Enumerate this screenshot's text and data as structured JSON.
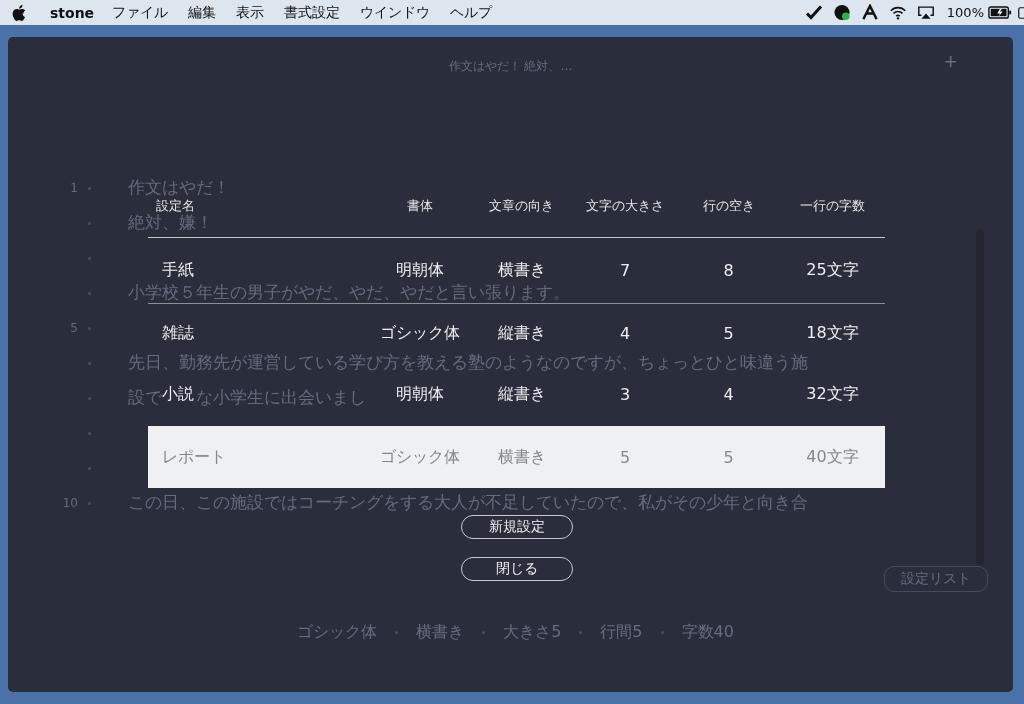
{
  "menu_bar": {
    "app": "stone",
    "menus": [
      "ファイル",
      "編集",
      "表示",
      "書式設定",
      "ウインドウ",
      "ヘルプ"
    ],
    "battery_percent": "100%"
  },
  "window": {
    "title": "作文はやだ！ 絶対、…",
    "add_button": "+"
  },
  "document": {
    "lines": [
      {
        "kind": "text",
        "number": "1",
        "segments": [
          "作文はやだ！"
        ]
      },
      {
        "kind": "text",
        "segments": [
          "絶対、嫌！"
        ]
      },
      {
        "kind": "blank"
      },
      {
        "kind": "text",
        "segments": [
          "小学校５年生の男子がやだ、やだ、やだと言い張ります。"
        ]
      },
      {
        "kind": "blank",
        "number": "5"
      },
      {
        "kind": "text",
        "segments": [
          "先日、勤務先が運営している学び方を教える塾のようなのですが、ちょっとひと味違う施"
        ]
      },
      {
        "kind": "text",
        "segments": [
          "設で",
          "な小学生に出会いまし"
        ]
      },
      {
        "kind": "blank"
      },
      {
        "kind": "blank"
      },
      {
        "kind": "text",
        "number": "10",
        "segments": [
          "この日、この施設ではコーチングをする大人が不足していたので、私がその少年と向き合"
        ]
      }
    ]
  },
  "settings_dialog": {
    "columns": [
      "設定名",
      "書体",
      "文章の向き",
      "文字の大きさ",
      "行の空き",
      "一行の字数"
    ],
    "rows": [
      {
        "name": "手紙",
        "font": "明朝体",
        "direction": "横書き",
        "size": "7",
        "spacing": "8",
        "chars": "25文字",
        "selected": false
      },
      {
        "name": "雑誌",
        "font": "ゴシック体",
        "direction": "縦書き",
        "size": "4",
        "spacing": "5",
        "chars": "18文字",
        "selected": false
      },
      {
        "name": "小説",
        "font": "明朝体",
        "direction": "縦書き",
        "size": "3",
        "spacing": "4",
        "chars": "32文字",
        "selected": false
      },
      {
        "name": "レポート",
        "font": "ゴシック体",
        "direction": "横書き",
        "size": "5",
        "spacing": "5",
        "chars": "40文字",
        "selected": true
      }
    ],
    "buttons": [
      "新規設定",
      "閉じる"
    ]
  },
  "footer": {
    "settings_list_button": "設定リスト",
    "status": [
      "ゴシック体",
      "横書き",
      "大きさ5",
      "行間5",
      "字数40"
    ]
  }
}
